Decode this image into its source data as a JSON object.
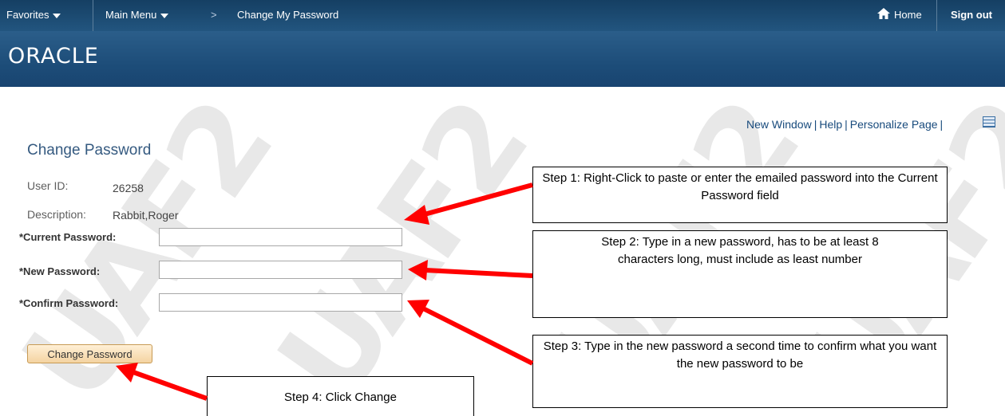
{
  "topbar": {
    "favorites": "Favorites",
    "main_menu": "Main Menu",
    "breadcrumb_sep": ">",
    "breadcrumb_current": "Change My Password",
    "home": "Home",
    "sign_out": "Sign out"
  },
  "banner": {
    "logo": "ORACLE"
  },
  "page_links": {
    "new_window": "New Window",
    "help": "Help",
    "personalize": "Personalize Page",
    "separator": "|"
  },
  "watermark": "UAF2",
  "form": {
    "title": "Change Password",
    "user_id_label": "User ID:",
    "user_id_value": "26258",
    "description_label": "Description:",
    "description_value": "Rabbit,Roger",
    "current_password_label": "*Current Password:",
    "current_password_value": "",
    "new_password_label": "*New Password:",
    "new_password_value": "",
    "confirm_password_label": "*Confirm Password:",
    "confirm_password_value": "",
    "submit_label": "Change Password"
  },
  "callouts": {
    "step1": "Step 1: Right-Click to paste or enter the emailed password into the Current Password field",
    "step2": "Step 2: Type in a new password, has to be at least 8 characters long, must include as least number",
    "step3": "Step 3: Type in the new password a second time to confirm what you want the new password to be",
    "step4": "Step 4: Click Change"
  },
  "colors": {
    "nav_bg": "#1b4a72",
    "title": "#355a80",
    "link": "#174a7c",
    "arrow": "#ff0000",
    "button_bg": "#f4d3a1"
  }
}
